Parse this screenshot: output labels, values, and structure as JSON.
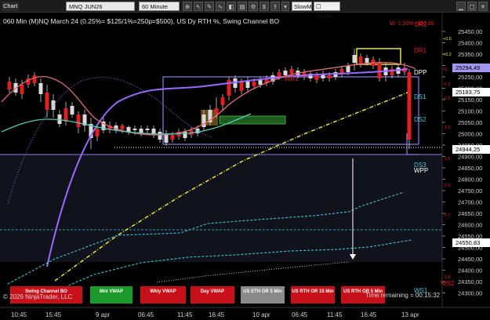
{
  "toolbar": {
    "chart_label": "Chart",
    "instrument": "MNQ JUN26",
    "interval": "60 Minute",
    "indicator": "SlowMA",
    "indicator_mode": "Visible"
  },
  "chart_title": "060 Min (M)NQ March 24  (0.25%= $125/1%=250p=$500), US Dy RTH %, Swing Channel BO",
  "pnl_label": "W -1,33% -337,00",
  "price_axis": {
    "ticks": [
      "25450,00",
      "25400,00",
      "25350,00",
      "25300,00",
      "25250,00",
      "25200,00",
      "25150,00",
      "25100,00",
      "25050,00",
      "25000,00",
      "24950,00",
      "24900,00",
      "24850,00",
      "24800,00",
      "24750,00",
      "24700,00",
      "24650,00",
      "24600,00",
      "24550,00",
      "24500,00",
      "24450,00",
      "24400,00",
      "24350,00",
      "24300,00"
    ],
    "pct_labels": [
      "+0.5",
      "+0.2",
      "CL",
      "-0.2",
      "-0.5",
      "-1.0",
      "-1.5",
      "-2.5",
      "-2.7",
      "-3.5"
    ]
  },
  "price_flags": [
    {
      "text": "25294,49",
      "bg": "#9f97f0",
      "fg": "#000"
    },
    {
      "text": "25183,75",
      "bg": "#fff",
      "fg": "#000"
    },
    {
      "text": "24944,25",
      "bg": "#fff",
      "fg": "#000"
    },
    {
      "text": "24550,83",
      "bg": "#fff",
      "fg": "#000"
    }
  ],
  "levels": {
    "dr1": "DR1",
    "dpp": "DPP",
    "ds1": "DS1",
    "ds2": "DS2",
    "ds3": "DS3",
    "wpp": "WPP",
    "wr1": "WR1",
    "dr2": "DR2",
    "ws1": "WS1",
    "ws2": "WS2"
  },
  "time_axis": [
    "10:45",
    "15:45",
    "9 apr",
    "06:45",
    "11:45",
    "16:45",
    "10 apr",
    "06:45",
    "11:45",
    "16:45",
    "13 apr"
  ],
  "vwap_buttons": [
    {
      "label": "Swing Channel BO",
      "color": "#c8101a"
    },
    {
      "label": "Mnt VWAP",
      "color": "#1a9a2a"
    },
    {
      "label": "Wkly VWAP",
      "color": "#c8101a"
    },
    {
      "label": "Day VWAP",
      "color": "#c8101a"
    },
    {
      "label": "US ETH OR 5 Min",
      "color": "#8a8a8a"
    },
    {
      "label": "US RTH OR 15 Min",
      "color": "#c8101a"
    },
    {
      "label": "US RTH OR 5 Min",
      "color": "#c8101a"
    }
  ],
  "copyright": "© 2026 NinjaTrader, LLC",
  "bar_timer": "Time remaining = 00:15:32",
  "colors": {
    "background": "#000000",
    "up_candle": "#d9d9d9",
    "down_candle": "#e0201e",
    "channel": "#8b80e8",
    "slow_ma": "#9b6bff",
    "fast_ma": "#e06a7a",
    "vwap": "#e7e23a",
    "band": "#3ec6d6"
  }
}
